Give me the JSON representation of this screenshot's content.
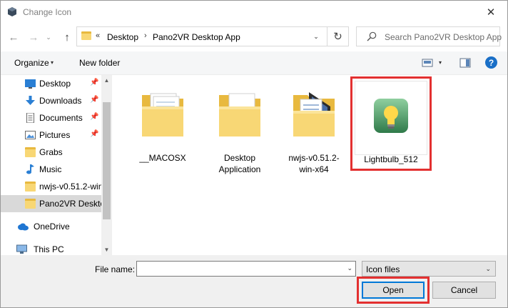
{
  "window": {
    "title": "Change Icon",
    "close_glyph": "✕"
  },
  "nav": {
    "back_glyph": "←",
    "forward_glyph": "→",
    "history_glyph": "⌄",
    "up_glyph": "↑",
    "refresh_glyph": "↻"
  },
  "address": {
    "overflow": "«",
    "separator": "›",
    "parts": [
      "Desktop",
      "Pano2VR Desktop App"
    ],
    "dropdown_glyph": "⌄"
  },
  "search": {
    "placeholder": "Search Pano2VR Desktop App"
  },
  "toolbar": {
    "organize_label": "Organize",
    "dropdown_glyph": "▾",
    "new_folder_label": "New folder",
    "help_label": "?"
  },
  "sidebar": {
    "pin_glyph": "📌",
    "items": [
      {
        "label": "Desktop",
        "icon": "desktop-icon",
        "pinned": true,
        "selected": false
      },
      {
        "label": "Downloads",
        "icon": "download-icon",
        "pinned": true,
        "selected": false
      },
      {
        "label": "Documents",
        "icon": "documents-icon",
        "pinned": true,
        "selected": false
      },
      {
        "label": "Pictures",
        "icon": "pictures-icon",
        "pinned": true,
        "selected": false
      },
      {
        "label": "Grabs",
        "icon": "folder-icon",
        "pinned": false,
        "selected": false
      },
      {
        "label": "Music",
        "icon": "music-icon",
        "pinned": false,
        "selected": false
      },
      {
        "label": "nwjs-v0.51.2-win",
        "icon": "folder-icon",
        "pinned": false,
        "selected": false
      },
      {
        "label": "Pano2VR Deskto",
        "icon": "folder-icon",
        "pinned": false,
        "selected": true
      },
      {
        "label": "OneDrive",
        "icon": "cloud-icon",
        "pinned": false,
        "selected": false
      },
      {
        "label": "This PC",
        "icon": "computer-icon",
        "pinned": false,
        "selected": false
      }
    ],
    "scroll_up_glyph": "▲",
    "scroll_down_glyph": "▼"
  },
  "files": [
    {
      "label": "__MACOSX",
      "icon": "folder-with-documents-icon"
    },
    {
      "label": "Desktop Application",
      "icon": "folder-with-page-icon"
    },
    {
      "label": "nwjs-v0.51.2-win-x64",
      "icon": "folder-with-app-icon"
    },
    {
      "label": "Lightbulb_512",
      "icon": "lightbulb-icon"
    }
  ],
  "footer": {
    "file_name_label": "File name:",
    "file_name_value": "",
    "file_type_value": "Icon files",
    "open_label": "Open",
    "cancel_label": "Cancel"
  },
  "colors": {
    "highlight": "#e33030",
    "accent": "#0078d7",
    "folder": "#f8d775",
    "help": "#1a6fc7"
  }
}
